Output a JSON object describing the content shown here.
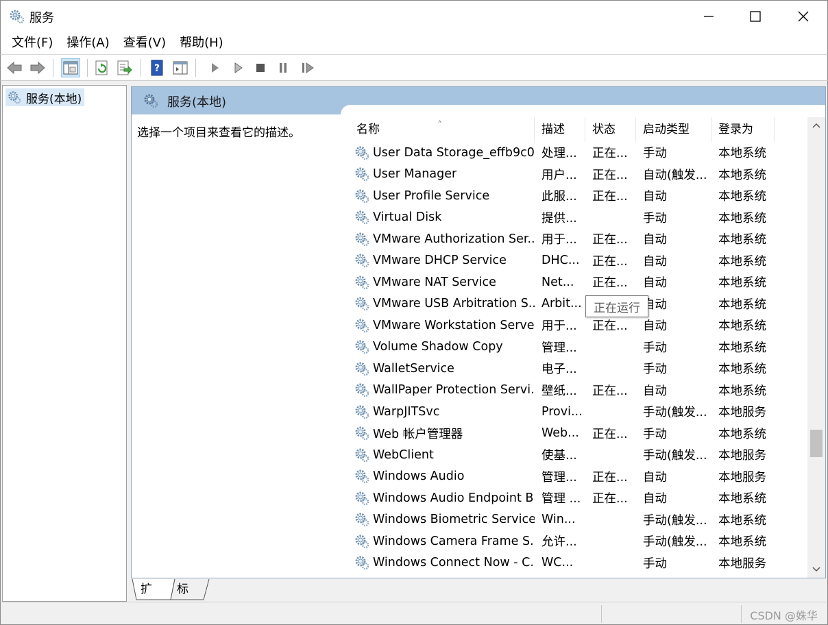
{
  "window": {
    "title": "服务"
  },
  "menu": [
    "文件(F)",
    "操作(A)",
    "查看(V)",
    "帮助(H)"
  ],
  "tree": {
    "root_label": "服务(本地)"
  },
  "panel": {
    "header_title": "服务(本地)",
    "description_prompt": "选择一个项目来查看它的描述。"
  },
  "columns": {
    "name": "名称",
    "description": "描述",
    "status": "状态",
    "startup_type": "启动类型",
    "log_on_as": "登录为"
  },
  "services": [
    {
      "name": "User Data Storage_effb9c0",
      "description": "处理...",
      "status": "正在...",
      "startup": "手动",
      "logon": "本地系统"
    },
    {
      "name": "User Manager",
      "description": "用户...",
      "status": "正在...",
      "startup": "自动(触发...",
      "logon": "本地系统"
    },
    {
      "name": "User Profile Service",
      "description": "此服...",
      "status": "正在...",
      "startup": "自动",
      "logon": "本地系统"
    },
    {
      "name": "Virtual Disk",
      "description": "提供...",
      "status": "",
      "startup": "手动",
      "logon": "本地系统"
    },
    {
      "name": "VMware Authorization Ser...",
      "description": "用于...",
      "status": "正在...",
      "startup": "自动",
      "logon": "本地系统"
    },
    {
      "name": "VMware DHCP Service",
      "description": "DHC...",
      "status": "正在...",
      "startup": "自动",
      "logon": "本地系统"
    },
    {
      "name": "VMware NAT Service",
      "description": "Net...",
      "status": "正在...",
      "startup": "自动",
      "logon": "本地系统"
    },
    {
      "name": "VMware USB Arbitration S...",
      "description": "Arbit...",
      "status": "",
      "startup": "自动",
      "logon": "本地系统"
    },
    {
      "name": "VMware Workstation Server",
      "description": "用于...",
      "status": "正在...",
      "startup": "自动",
      "logon": "本地系统"
    },
    {
      "name": "Volume Shadow Copy",
      "description": "管理...",
      "status": "",
      "startup": "手动",
      "logon": "本地系统"
    },
    {
      "name": "WalletService",
      "description": "电子...",
      "status": "",
      "startup": "手动",
      "logon": "本地系统"
    },
    {
      "name": "WallPaper Protection Servi...",
      "description": "壁纸...",
      "status": "正在...",
      "startup": "自动",
      "logon": "本地系统"
    },
    {
      "name": "WarpJITSvc",
      "description": "Provi...",
      "status": "",
      "startup": "手动(触发...",
      "logon": "本地服务"
    },
    {
      "name": "Web 帐户管理器",
      "description": "Web...",
      "status": "正在...",
      "startup": "手动",
      "logon": "本地系统"
    },
    {
      "name": "WebClient",
      "description": "使基...",
      "status": "",
      "startup": "手动(触发...",
      "logon": "本地服务"
    },
    {
      "name": "Windows Audio",
      "description": "管理...",
      "status": "正在...",
      "startup": "自动",
      "logon": "本地服务"
    },
    {
      "name": "Windows Audio Endpoint B...",
      "description": "管理 ...",
      "status": "正在...",
      "startup": "自动",
      "logon": "本地系统"
    },
    {
      "name": "Windows Biometric Service",
      "description": "Win...",
      "status": "",
      "startup": "手动(触发...",
      "logon": "本地系统"
    },
    {
      "name": "Windows Camera Frame S...",
      "description": "允许...",
      "status": "",
      "startup": "手动(触发...",
      "logon": "本地系统"
    },
    {
      "name": "Windows Connect Now - C...",
      "description": "WC...",
      "status": "",
      "startup": "手动",
      "logon": "本地服务"
    }
  ],
  "tooltip": "正在运行",
  "tabs": [
    "扩展",
    "标准"
  ],
  "watermark": "CSDN @姝华",
  "colors": {
    "header_bg": "#a6c3df",
    "selection_bg": "#d9e9f8",
    "gear": "#6b8fb0"
  }
}
